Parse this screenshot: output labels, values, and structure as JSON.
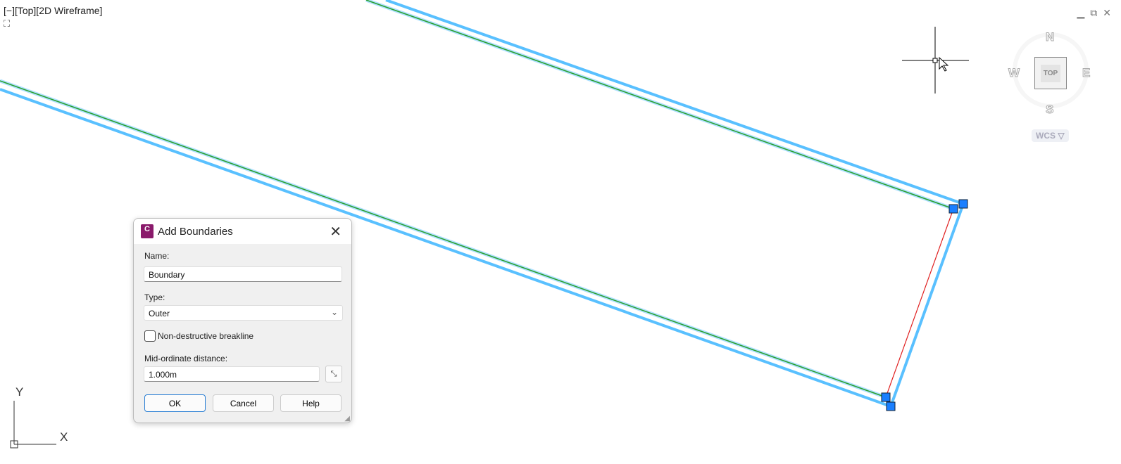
{
  "viewport": {
    "label": "[−][Top][2D Wireframe]"
  },
  "window_controls": {
    "minimize": "▁",
    "restore": "⧉",
    "close": "✕"
  },
  "viewcube": {
    "face": "TOP",
    "north": "N",
    "south": "S",
    "east": "E",
    "west": "W",
    "ucs": "WCS ▽"
  },
  "ucs_icon": {
    "x": "X",
    "y": "Y"
  },
  "colors": {
    "selection": "#59c0ff",
    "feature_line": "#2aa02a",
    "boundary": "#e02020",
    "grip": "#1a7fff"
  },
  "dialog": {
    "app_icon": "C",
    "title": "Add Boundaries",
    "name_label": "Name:",
    "name_value": "Boundary",
    "type_label": "Type:",
    "type_value": "Outer",
    "checkbox_label": "Non-destructive breakline",
    "checkbox_checked": false,
    "midordinate_label": "Mid-ordinate distance:",
    "midordinate_value": "1.000m",
    "ok": "OK",
    "cancel": "Cancel",
    "help": "Help"
  }
}
